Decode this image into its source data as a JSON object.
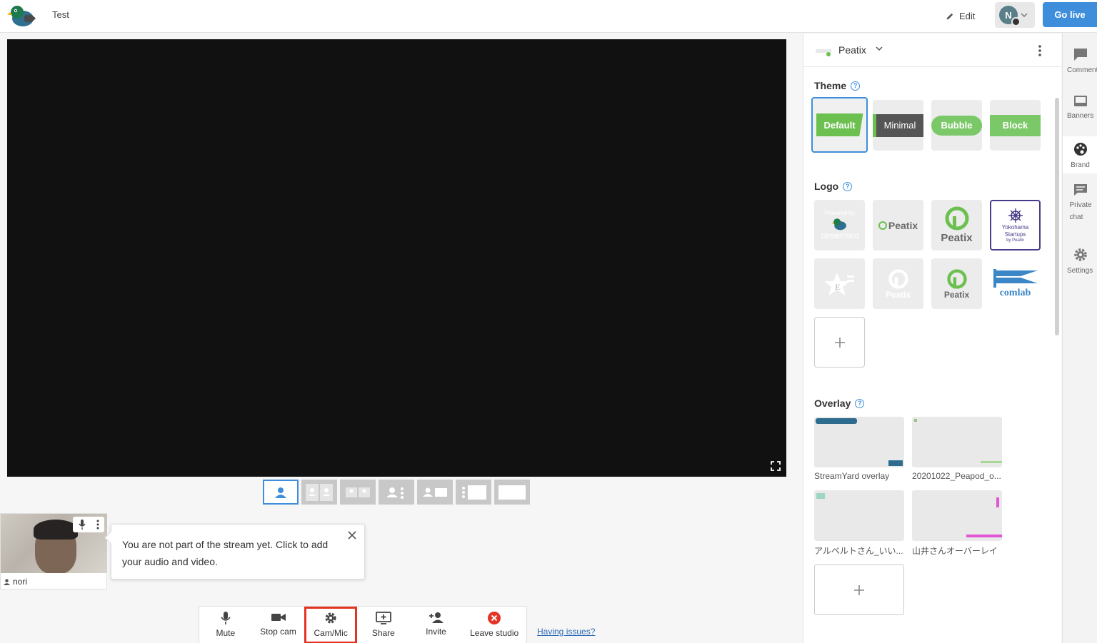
{
  "header": {
    "studio_title": "Test",
    "edit_label": "Edit",
    "avatar_initial": "N",
    "go_live_label": "Go live"
  },
  "tooltip": {
    "message": "You are not part of the stream yet. Click to add your audio and video."
  },
  "participant": {
    "name": "nori"
  },
  "toolbar": {
    "mute": "Mute",
    "stop_cam": "Stop cam",
    "cam_mic": "Cam/Mic",
    "share": "Share",
    "invite": "Invite",
    "leave": "Leave studio",
    "issues": "Having issues?"
  },
  "panel": {
    "brand_name": "Peatix",
    "theme_title": "Theme",
    "themes": [
      "Default",
      "Minimal",
      "Bubble",
      "Block"
    ],
    "logo_title": "Logo",
    "logo_texts": {
      "powered_by": "Powered by",
      "streamyard": "StreamYard",
      "peatix": "Peatix",
      "yokohama_1": "Yokohama",
      "yokohama_2": "Startups",
      "yokohama_by": "by Peatix",
      "comlab": "comlab"
    },
    "overlay_title": "Overlay",
    "overlays": [
      "StreamYard overlay",
      "20201022_Peapod_o...",
      "アルベルトさん_いい...",
      "山井さんオーバーレイ"
    ]
  },
  "sidetabs": [
    "Comments",
    "Banners",
    "Brand",
    "Private chat",
    "Settings"
  ],
  "colors": {
    "accent": "#3f8edc",
    "green": "#6cc050",
    "highlight": "#e53323"
  }
}
